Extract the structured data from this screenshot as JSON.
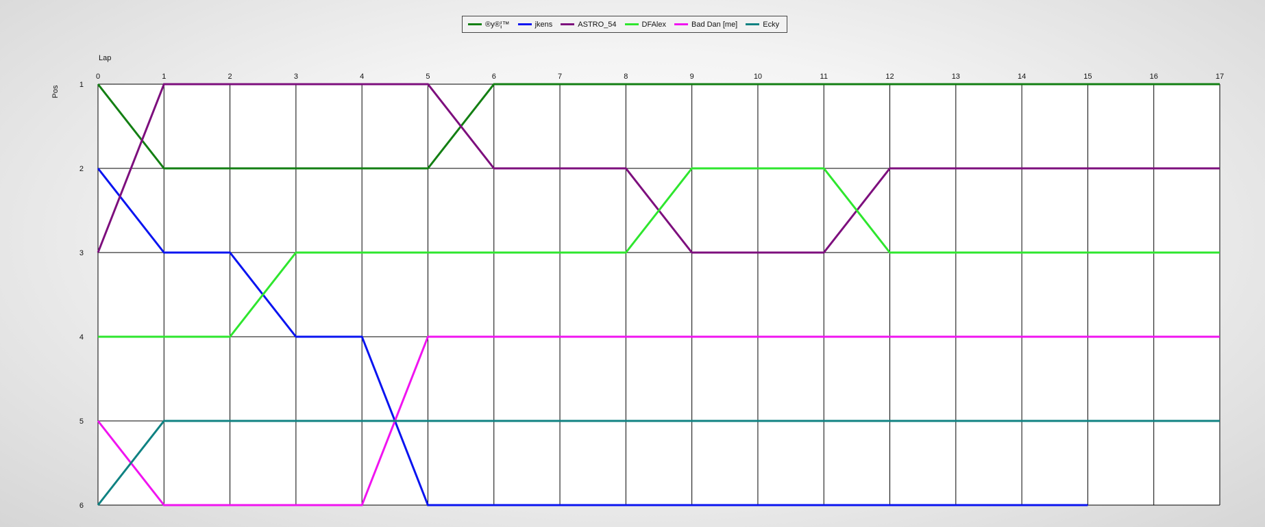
{
  "chart_data": {
    "type": "line",
    "xlabel": "Lap",
    "ylabel": "Pos",
    "x_ticks": [
      0,
      1,
      2,
      3,
      4,
      5,
      6,
      7,
      8,
      9,
      10,
      11,
      12,
      13,
      14,
      15,
      16,
      17
    ],
    "y_ticks": [
      1,
      2,
      3,
      4,
      5,
      6
    ],
    "xlim": [
      0,
      17
    ],
    "ylim": [
      1,
      6
    ],
    "y_inverted": true,
    "grid": true,
    "legend_position": "top-center",
    "series": [
      {
        "name": "®у®¦™",
        "color": "#137f13",
        "x": [
          0,
          1,
          2,
          3,
          4,
          5,
          6,
          7,
          8,
          9,
          10,
          11,
          12,
          13,
          14,
          15,
          16,
          17
        ],
        "y": [
          1,
          2,
          2,
          2,
          2,
          2,
          1,
          1,
          1,
          1,
          1,
          1,
          1,
          1,
          1,
          1,
          1,
          1
        ]
      },
      {
        "name": "jkens",
        "color": "#0a14f0",
        "x": [
          0,
          1,
          2,
          3,
          4,
          5,
          6,
          7,
          8,
          9,
          10,
          11,
          12,
          13,
          14,
          15
        ],
        "y": [
          2,
          3,
          3,
          4,
          4,
          6,
          6,
          6,
          6,
          6,
          6,
          6,
          6,
          6,
          6,
          6
        ]
      },
      {
        "name": "ASTRO_54",
        "color": "#7d0f7d",
        "x": [
          0,
          1,
          2,
          3,
          4,
          5,
          6,
          7,
          8,
          9,
          10,
          11,
          12,
          13,
          14,
          15,
          16,
          17
        ],
        "y": [
          3,
          1,
          1,
          1,
          1,
          1,
          2,
          2,
          2,
          3,
          3,
          3,
          2,
          2,
          2,
          2,
          2,
          2
        ]
      },
      {
        "name": "DFAlex",
        "color": "#2ee62e",
        "x": [
          0,
          1,
          2,
          3,
          4,
          5,
          6,
          7,
          8,
          9,
          10,
          11,
          12,
          13,
          14,
          15,
          16,
          17
        ],
        "y": [
          4,
          4,
          4,
          3,
          3,
          3,
          3,
          3,
          3,
          2,
          2,
          2,
          3,
          3,
          3,
          3,
          3,
          3
        ]
      },
      {
        "name": "Bad Dan [me]",
        "color": "#f014f0",
        "x": [
          0,
          1,
          2,
          3,
          4,
          5,
          6,
          7,
          8,
          9,
          10,
          11,
          12,
          13,
          14,
          15,
          16,
          17
        ],
        "y": [
          5,
          6,
          6,
          6,
          6,
          4,
          4,
          4,
          4,
          4,
          4,
          4,
          4,
          4,
          4,
          4,
          4,
          4
        ]
      },
      {
        "name": "Ecky",
        "color": "#0f8282",
        "x": [
          0,
          1,
          2,
          3,
          4,
          5,
          6,
          7,
          8,
          9,
          10,
          11,
          12,
          13,
          14,
          15,
          16,
          17
        ],
        "y": [
          6,
          5,
          5,
          5,
          5,
          5,
          5,
          5,
          5,
          5,
          5,
          5,
          5,
          5,
          5,
          5,
          5,
          5
        ]
      }
    ]
  }
}
